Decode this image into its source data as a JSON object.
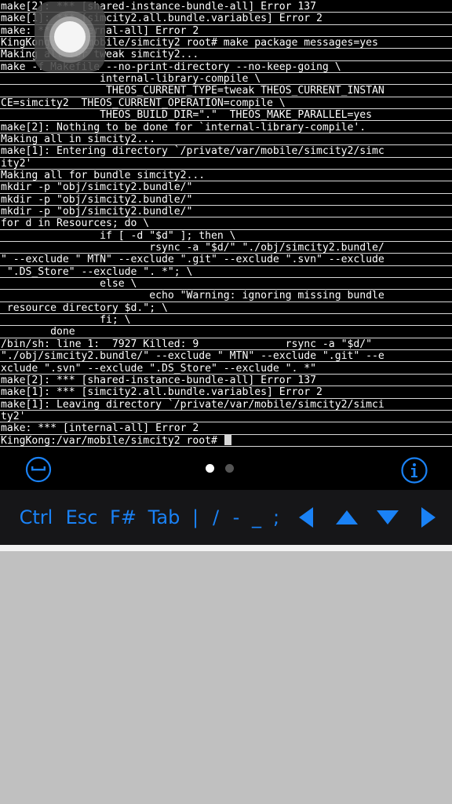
{
  "terminal": {
    "lines": [
      "make[2]: *** [shared-instance-bundle-all] Error 137",
      "make[1]: *** [simcity2.all.bundle.variables] Error 2",
      "make: *** [internal-all] Error 2",
      "KingKong:/var/mobile/simcity2 root# make package messages=yes",
      "Making all for tweak simcity2...",
      "make -f Makefile --no-print-directory --no-keep-going \\",
      "                internal-library-compile \\",
      "                 THEOS_CURRENT_TYPE=tweak THEOS_CURRENT_INSTAN",
      "CE=simcity2  THEOS_CURRENT_OPERATION=compile \\",
      "                THEOS_BUILD_DIR=\".\"  THEOS_MAKE_PARALLEL=yes",
      "make[2]: Nothing to be done for `internal-library-compile'.",
      "Making all in simcity2...",
      "make[1]: Entering directory `/private/var/mobile/simcity2/simc",
      "ity2'",
      "Making all for bundle simcity2...",
      "mkdir -p \"obj/simcity2.bundle/\"",
      "mkdir -p \"obj/simcity2.bundle/\"",
      "mkdir -p \"obj/simcity2.bundle/\"",
      "for d in Resources; do \\",
      "                if [ -d \"$d\" ]; then \\",
      "                        rsync -a \"$d/\" \"./obj/simcity2.bundle/",
      "\" --exclude \" MTN\" --exclude \".git\" --exclude \".svn\" --exclude",
      " \".DS_Store\" --exclude \". *\"; \\",
      "                else \\",
      "                        echo \"Warning: ignoring missing bundle",
      " resource directory $d.\"; \\",
      "                fi; \\",
      "        done",
      "/bin/sh: line 1:  7927 Killed: 9              rsync -a \"$d/\"",
      "\"./obj/simcity2.bundle/\" --exclude \" MTN\" --exclude \".git\" --e",
      "xclude \".svn\" --exclude \".DS_Store\" --exclude \". *\"",
      "make[2]: *** [shared-instance-bundle-all] Error 137",
      "make[1]: *** [simcity2.all.bundle.variables] Error 2",
      "make[1]: Leaving directory `/private/var/mobile/simcity2/simci",
      "ty2'",
      "make: *** [internal-all] Error 2",
      "KingKong:/var/mobile/simcity2 root# "
    ]
  },
  "overlay": {
    "assistive_touch_icon": "assistive-touch-icon"
  },
  "control_bar": {
    "left_icon": "keyboard-toggle-icon",
    "right_icon": "info-icon",
    "pages": 2,
    "active_page": 1
  },
  "keys": {
    "ctrl": "Ctrl",
    "esc": "Esc",
    "fn": "F#",
    "tab": "Tab",
    "pipe": "|",
    "slash": "/",
    "dash": "-",
    "underscore": "_",
    "semicolon": ";",
    "arrow_left_icon": "arrow-left-icon",
    "arrow_up_icon": "arrow-up-icon",
    "arrow_down_icon": "arrow-down-icon",
    "arrow_right_icon": "arrow-right-icon"
  },
  "colors": {
    "terminal_bg": "#000000",
    "terminal_text": "#ffffff",
    "accent": "#1a82f6",
    "keybar_bg": "#161618",
    "background": "#c0c0c0"
  }
}
